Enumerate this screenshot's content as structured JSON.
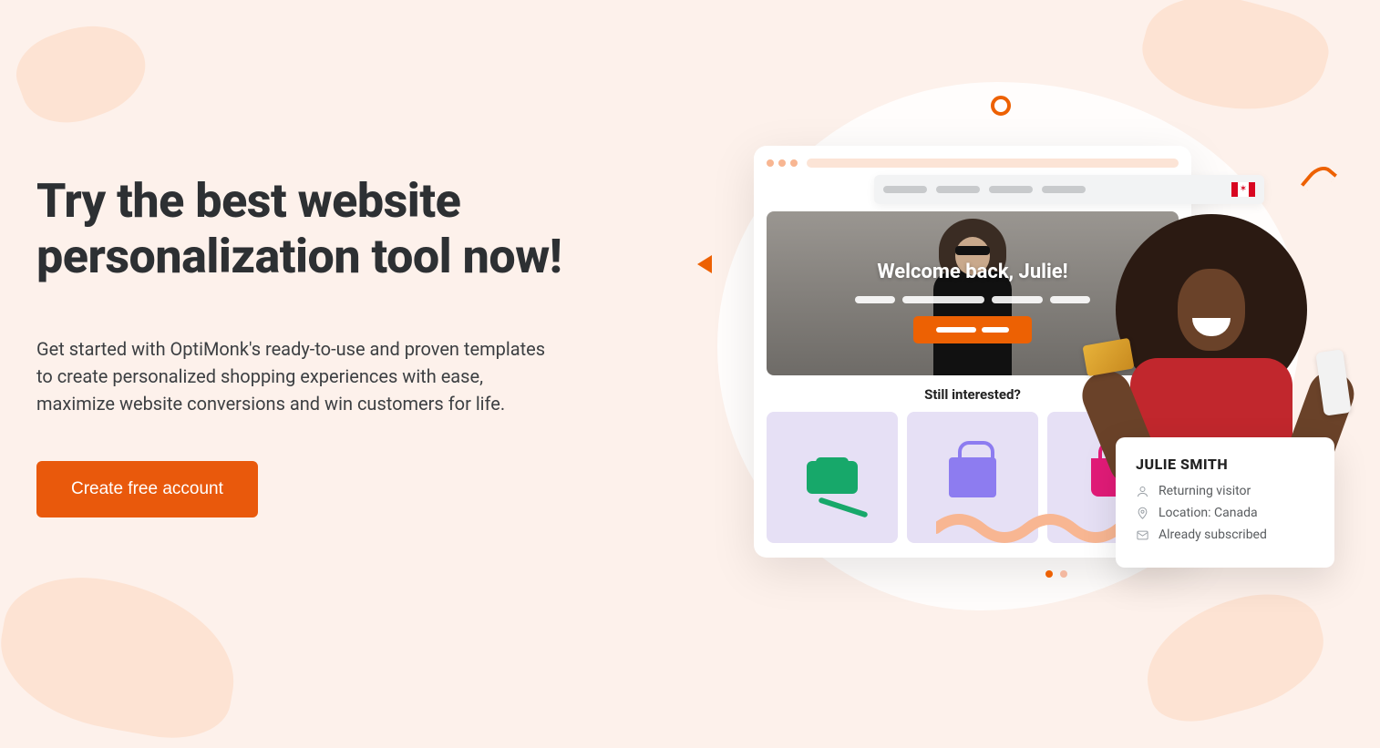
{
  "hero": {
    "headline": "Try the best website personalization tool now!",
    "subhead": "Get started with OptiMonk's ready-to-use and proven templates to create personalized shopping experiences with ease, maximize website conversions and win customers for life.",
    "cta_label": "Create free account"
  },
  "mock": {
    "welcome_text": "Welcome back, Julie!",
    "interested_title": "Still interested?",
    "flag_country": "Canada"
  },
  "visitor_card": {
    "name": "JULIE SMITH",
    "status": "Returning visitor",
    "location": "Location: Canada",
    "subscribed": "Already subscribed"
  },
  "colors": {
    "accent": "#ED6103",
    "bg": "#FDF1EB"
  }
}
